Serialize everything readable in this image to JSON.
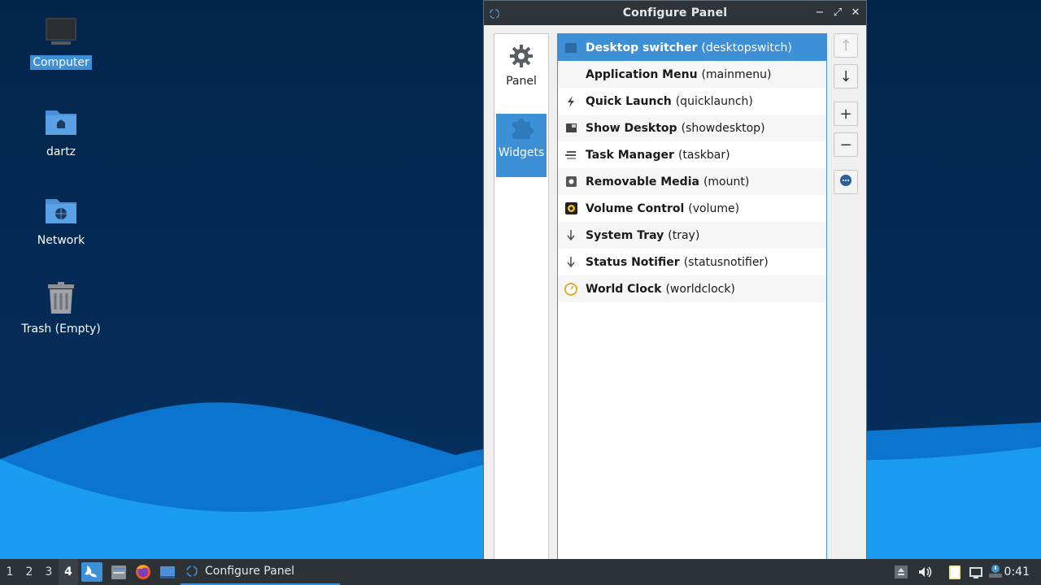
{
  "desktop": {
    "icons": [
      {
        "label": "Computer",
        "icon": "computer-icon"
      },
      {
        "label": "dartz",
        "icon": "home-folder-icon"
      },
      {
        "label": "Network",
        "icon": "network-folder-icon"
      },
      {
        "label": "Trash (Empty)",
        "icon": "trash-icon"
      }
    ]
  },
  "window": {
    "title": "Configure Panel",
    "sidebar": [
      {
        "label": "Panel",
        "icon": "gear-icon"
      },
      {
        "label": "Widgets",
        "icon": "puzzle-icon"
      }
    ],
    "plugins": [
      {
        "name": "Desktop switcher",
        "id": "(desktopswitch)",
        "icon": "desktop-switcher-icon"
      },
      {
        "name": "Application Menu",
        "id": "(mainmenu)",
        "icon": "app-menu-icon"
      },
      {
        "name": "Quick Launch",
        "id": "(quicklaunch)",
        "icon": "lightning-icon"
      },
      {
        "name": "Show Desktop",
        "id": "(showdesktop)",
        "icon": "show-desktop-icon"
      },
      {
        "name": "Task Manager",
        "id": "(taskbar)",
        "icon": "task-manager-icon"
      },
      {
        "name": "Removable Media",
        "id": "(mount)",
        "icon": "removable-media-icon"
      },
      {
        "name": "Volume Control",
        "id": "(volume)",
        "icon": "volume-icon"
      },
      {
        "name": "System Tray",
        "id": "(tray)",
        "icon": "tray-icon"
      },
      {
        "name": "Status Notifier",
        "id": "(statusnotifier)",
        "icon": "notifier-icon"
      },
      {
        "name": "World Clock",
        "id": "(worldclock)",
        "icon": "clock-icon"
      }
    ],
    "buttons": {
      "up": "↑",
      "down": "↓",
      "add": "+",
      "remove": "−"
    }
  },
  "taskbar": {
    "workspaces": [
      "1",
      "2",
      "3",
      "4"
    ],
    "active_workspace": "4",
    "task_label": "Configure Panel",
    "clock": "0:41"
  },
  "colors": {
    "accent": "#3d8fd6",
    "titlebar": "#2f3438",
    "taskbar": "#2d3236"
  }
}
